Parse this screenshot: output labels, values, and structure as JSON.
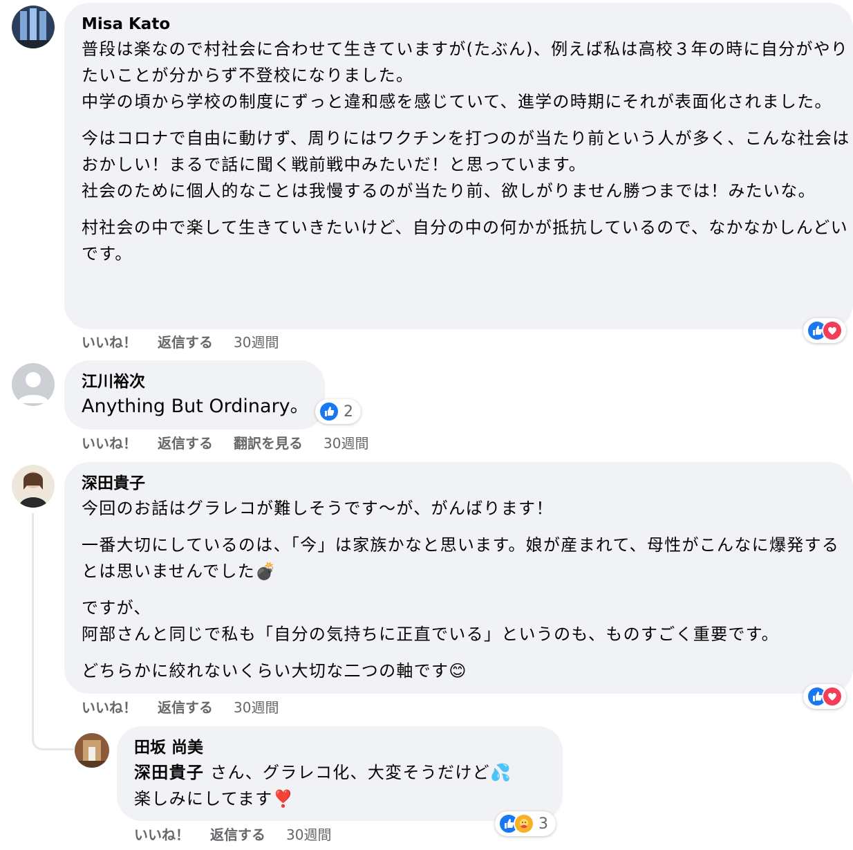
{
  "colors": {
    "bubble": "#f0f2f5",
    "like_blue": "#1877f2",
    "love_red": "#f33e58",
    "meta_gray": "#65676b"
  },
  "comments": [
    {
      "name": "Misa Kato",
      "lines": [
        "普段は楽なので村社会に合わせて生きていますが(たぶん)、例えば私は高校３年の時に自分がやりたいことが分からず不登校になりました。",
        "中学の頃から学校の制度にずっと違和感を感じていて、進学の時期にそれが表面化されました。",
        "今はコロナで自由に動けず、周りにはワクチンを打つのが当たり前という人が多く、こんな社会はおかしい！まるで話に聞く戦前戦中みたいだ！と思っています。",
        "社会のために個人的なことは我慢するのが当たり前、欲しがりません勝つまでは！みたいな。",
        "村社会の中で楽して生きていきたいけど、自分の中の何かが抵抗しているので、なかなかしんどいです。"
      ],
      "actions": {
        "like": "いいね！",
        "reply": "返信する",
        "time": "30週間"
      },
      "reactions": [
        "like-icon",
        "love-icon"
      ]
    },
    {
      "name": "江川裕次",
      "lines": [
        "Anything But Ordinary。"
      ],
      "actions": {
        "like": "いいね！",
        "reply": "返信する",
        "translate": "翻訳を見る",
        "time": "30週間"
      },
      "reactions": [
        "like-icon"
      ],
      "reaction_count": "2"
    },
    {
      "name": "深田貴子",
      "lines": [
        "今回のお話はグラレコが難しそうです〜が、がんばります！",
        "一番大切にしているのは、「今」は家族かなと思います。娘が産まれて、母性がこんなに爆発するとは思いませんでした",
        "💣",
        "ですが、",
        "阿部さんと同じで私も「自分の気持ちに正直でいる」というのも、ものすごく重要です。",
        "どちらかに絞れないくらい大切な二つの軸です",
        "😊"
      ],
      "actions": {
        "like": "いいね！",
        "reply": "返信する",
        "time": "30週間"
      },
      "reactions": [
        "like-icon",
        "love-icon"
      ]
    },
    {
      "name": "田坂 尚美",
      "mention": "深田貴子",
      "lines": [
        "さん、グラレコ化、大変そうだけど",
        "💦",
        "楽しみにしてます",
        "❣️"
      ],
      "actions": {
        "like": "いいね！",
        "reply": "返信する",
        "time": "30週間"
      },
      "reactions": [
        "like-icon",
        "care-icon"
      ],
      "reaction_count": "3"
    }
  ]
}
